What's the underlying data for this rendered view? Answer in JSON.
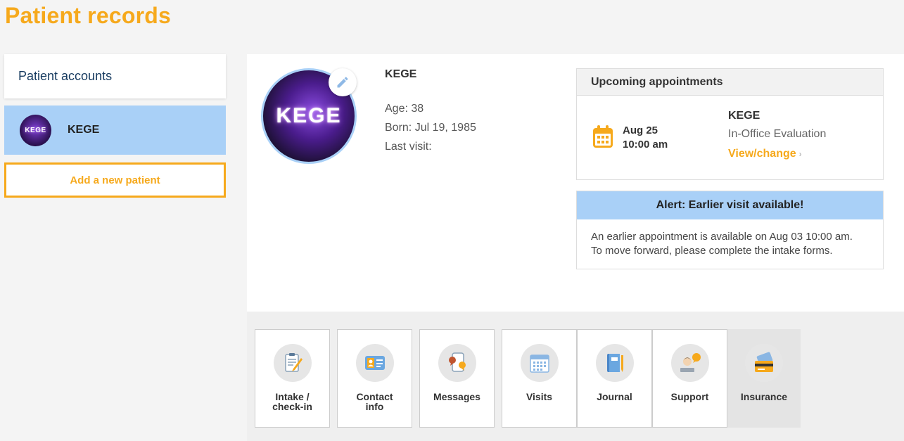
{
  "page": {
    "title": "Patient records"
  },
  "sidebar": {
    "header": "Patient accounts",
    "patients": [
      {
        "name": "KEGE",
        "avatar_text": "KEGE"
      }
    ],
    "add_label": "Add a new patient"
  },
  "profile": {
    "name": "KEGE",
    "photo_text": "KEGE",
    "age": "Age: 38",
    "born": "Born: Jul 19, 1985",
    "last_visit": "Last visit:"
  },
  "appointments": {
    "header": "Upcoming appointments",
    "date": "Aug 25",
    "time": "10:00 am",
    "patient": "KEGE",
    "type": "In-Office Evaluation",
    "link": "View/change",
    "link_chevron": "›"
  },
  "alert": {
    "header": "Alert: Earlier visit available!",
    "line1": "An earlier appointment is available on Aug 03 10:00 am.",
    "line2": "To move forward, please complete the intake forms."
  },
  "tiles": [
    {
      "line1": "Intake /",
      "line2": "check-in",
      "icon": "clipboard-pen-icon"
    },
    {
      "line1": "Contact",
      "line2": "info",
      "icon": "contact-card-icon"
    },
    {
      "line1": "Messages",
      "line2": "",
      "icon": "messages-icon"
    },
    {
      "line1": "Visits",
      "line2": "",
      "icon": "calendar-grid-icon"
    },
    {
      "line1": "Journal",
      "line2": "",
      "icon": "journal-book-icon"
    },
    {
      "line1": "Support",
      "line2": "",
      "icon": "support-agent-icon"
    },
    {
      "line1": "Insurance",
      "line2": "",
      "icon": "credit-card-icon"
    }
  ],
  "colors": {
    "accent": "#f6a91c",
    "highlight": "#a9d0f7",
    "navy": "#163a5f"
  }
}
